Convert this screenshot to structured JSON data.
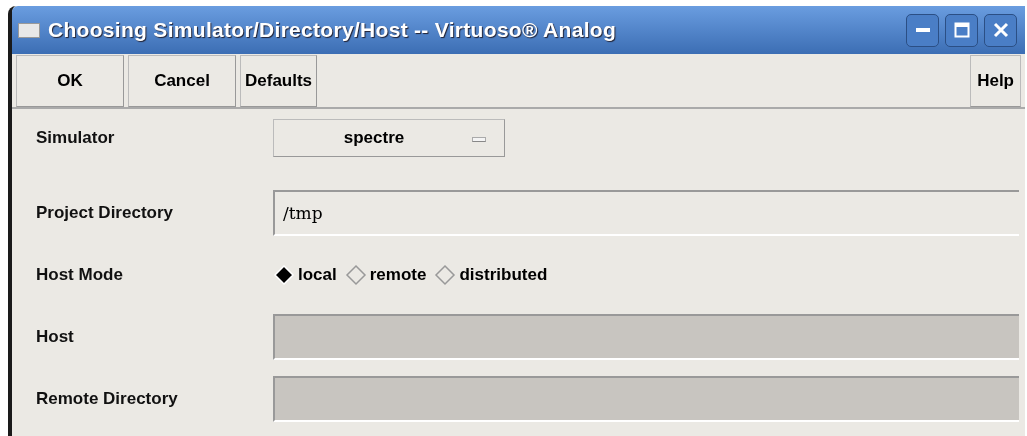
{
  "window": {
    "title": "Choosing Simulator/Directory/Host -- Virtuoso® Analog"
  },
  "buttons": [
    {
      "label": "OK"
    },
    {
      "label": "Cancel"
    },
    {
      "label": "Defaults"
    }
  ],
  "help_button": {
    "label": "Help"
  },
  "form": [
    {
      "kind": "cyclic",
      "label": "Simulator",
      "value": "spectre"
    },
    {
      "kind": "text",
      "label": "Project Directory",
      "value": "/tmp",
      "disabled": false
    },
    {
      "kind": "radio",
      "label": "Host Mode",
      "options": [
        {
          "label": "local",
          "selected": true
        },
        {
          "label": "remote",
          "selected": false
        },
        {
          "label": "distributed",
          "selected": false
        }
      ]
    },
    {
      "kind": "text",
      "label": "Host",
      "disabled": true
    },
    {
      "kind": "text",
      "label": "Remote Directory",
      "disabled": true
    }
  ]
}
